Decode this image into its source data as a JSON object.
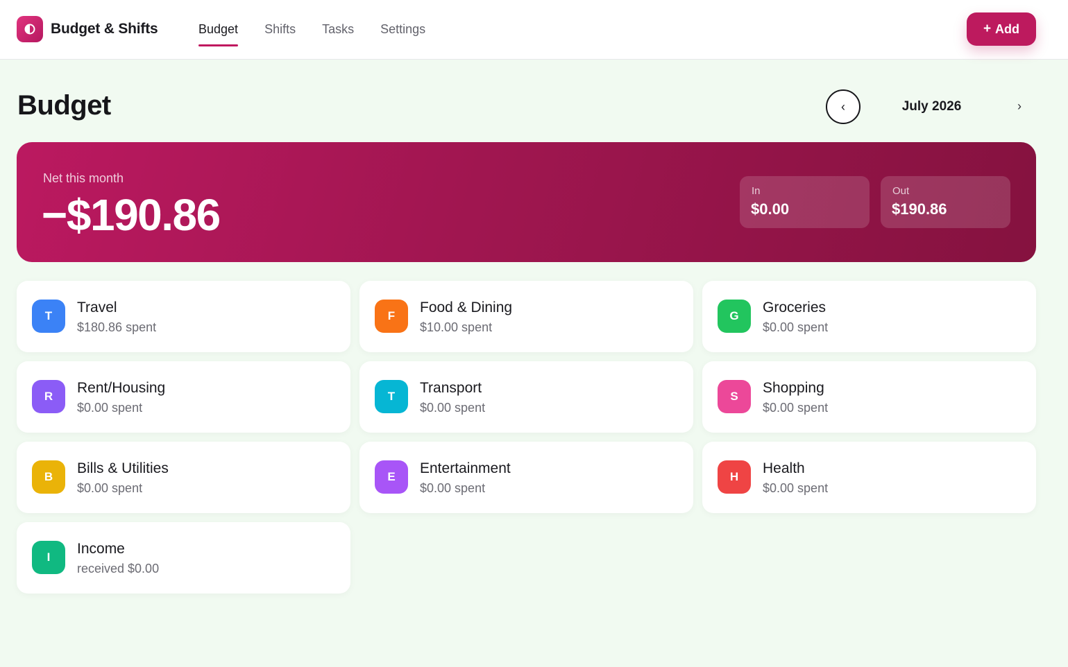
{
  "app": {
    "name": "Budget & Shifts",
    "logo_icon": "half-circle-icon"
  },
  "nav": {
    "tabs": [
      {
        "label": "Budget",
        "active": true
      },
      {
        "label": "Shifts",
        "active": false
      },
      {
        "label": "Tasks",
        "active": false
      },
      {
        "label": "Settings",
        "active": false
      }
    ]
  },
  "header": {
    "add_label": "Add",
    "add_icon": "+"
  },
  "page": {
    "title": "Budget",
    "month": "July 2026",
    "prev_icon": "‹",
    "next_icon": "›"
  },
  "summary": {
    "net_label": "Net this month",
    "net_value": "−$190.86",
    "in_label": "In",
    "in_value": "$0.00",
    "out_label": "Out",
    "out_value": "$190.86"
  },
  "categories": [
    {
      "initial": "T",
      "name": "Travel",
      "sub": "$180.86 spent",
      "color": "#3b82f6"
    },
    {
      "initial": "F",
      "name": "Food & Dining",
      "sub": "$10.00 spent",
      "color": "#f97316"
    },
    {
      "initial": "G",
      "name": "Groceries",
      "sub": "$0.00 spent",
      "color": "#22c55e"
    },
    {
      "initial": "R",
      "name": "Rent/Housing",
      "sub": "$0.00 spent",
      "color": "#8b5cf6"
    },
    {
      "initial": "T",
      "name": "Transport",
      "sub": "$0.00 spent",
      "color": "#06b6d4"
    },
    {
      "initial": "S",
      "name": "Shopping",
      "sub": "$0.00 spent",
      "color": "#ec4899"
    },
    {
      "initial": "B",
      "name": "Bills & Utilities",
      "sub": "$0.00 spent",
      "color": "#eab308"
    },
    {
      "initial": "E",
      "name": "Entertainment",
      "sub": "$0.00 spent",
      "color": "#a855f7"
    },
    {
      "initial": "H",
      "name": "Health",
      "sub": "$0.00 spent",
      "color": "#ef4444"
    },
    {
      "initial": "I",
      "name": "Income",
      "sub": "received $0.00",
      "color": "#10b981"
    }
  ],
  "colors": {
    "accent": "#bd1a5e",
    "banner_start": "#bb1960",
    "banner_end": "#85123f",
    "page_background": "#f1faf1"
  }
}
